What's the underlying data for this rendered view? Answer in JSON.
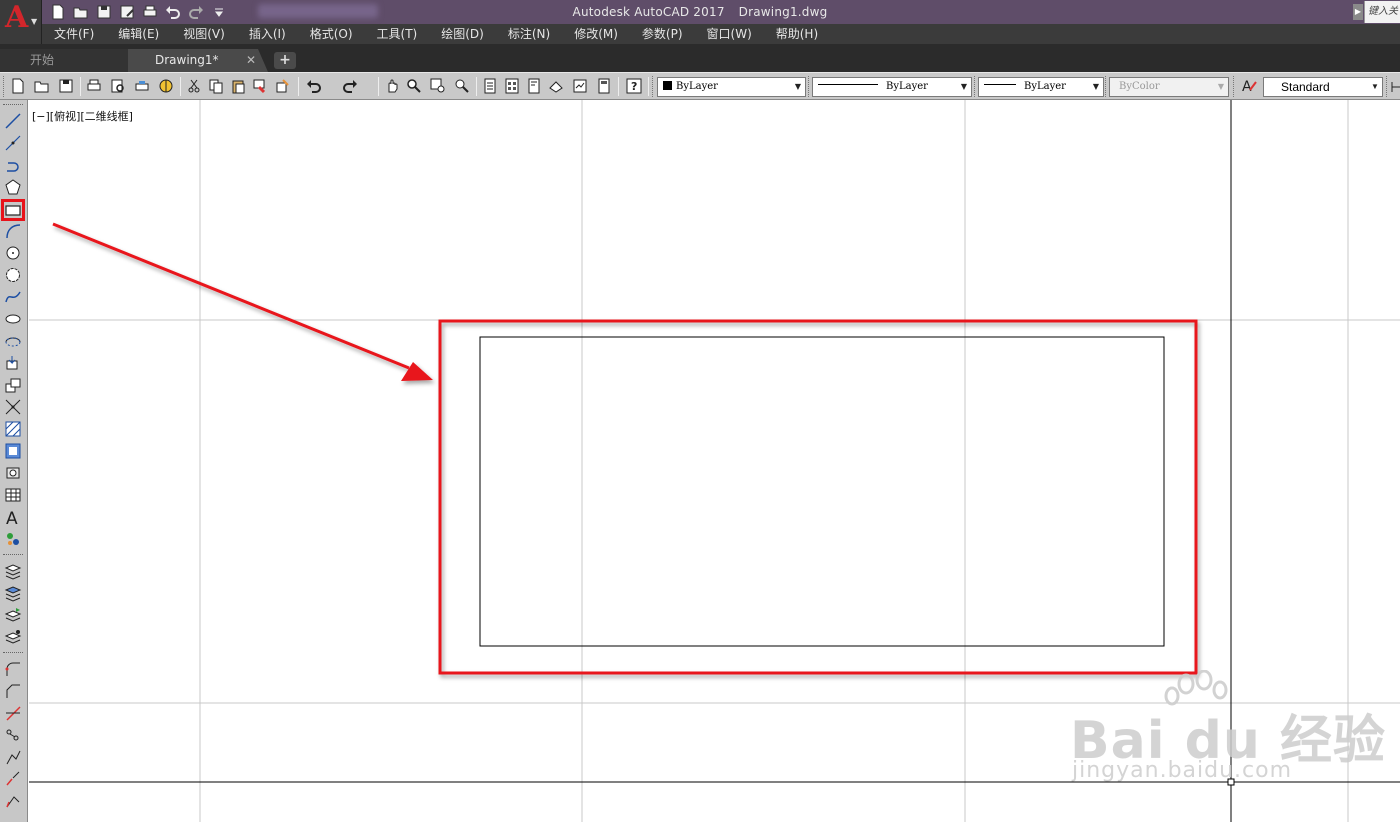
{
  "app": {
    "logo_letter": "A",
    "product": "Autodesk AutoCAD 2017",
    "document": "Drawing1.dwg",
    "search_placeholder": "键入关"
  },
  "menu": {
    "items": [
      "文件(F)",
      "编辑(E)",
      "视图(V)",
      "插入(I)",
      "格式(O)",
      "工具(T)",
      "绘图(D)",
      "标注(N)",
      "修改(M)",
      "参数(P)",
      "窗口(W)",
      "帮助(H)"
    ]
  },
  "tabs": {
    "start": "开始",
    "drawing": "Drawing1*",
    "close": "✕",
    "add": "+"
  },
  "properties": {
    "color": "ByLayer",
    "linetype": "ByLayer",
    "lineweight": "ByLayer",
    "plotstyle": "ByColor",
    "text_style": "Standard"
  },
  "viewport": {
    "label": "[−][俯视][二维线框]"
  },
  "watermark": {
    "brand": "Bai du 经验",
    "url": "jingyan.baidu.com"
  },
  "colors": {
    "annotation_red": "#e8131a",
    "titlebar": "#5f4d69",
    "menubar": "#3b3b3b",
    "toolbar": "#c9c9c9"
  }
}
